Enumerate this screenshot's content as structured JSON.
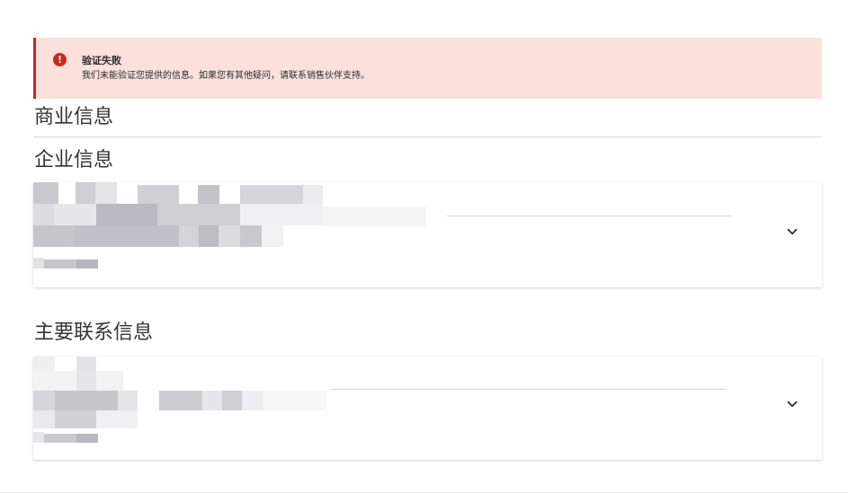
{
  "alert": {
    "icon": "exclamation-icon",
    "icon_glyph": "!",
    "title": "验证失败",
    "message": "我们未能验证您提供的信息。如果您有其他疑问，请联系销售伙伴支持。",
    "background": "#fbe0dc",
    "accent": "#c9271b"
  },
  "sections": {
    "business_title": "商业信息",
    "company_title": "企业信息",
    "contact_title": "主要联系信息"
  },
  "cards": {
    "company": {
      "expand_icon": "chevron-down-icon"
    },
    "contact": {
      "expand_icon": "chevron-down-icon"
    }
  }
}
